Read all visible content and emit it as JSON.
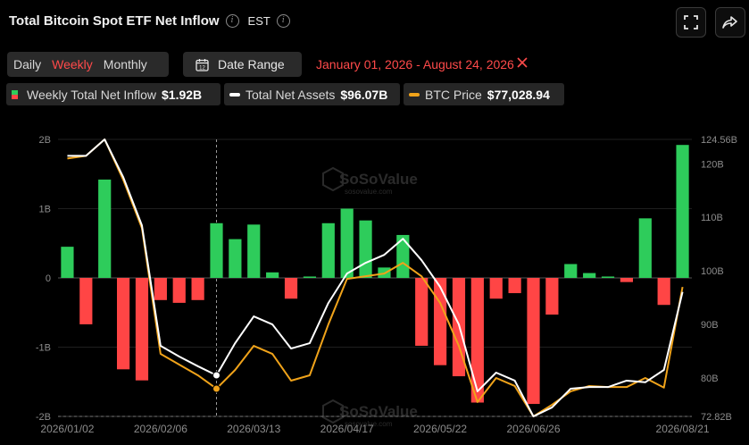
{
  "header": {
    "title": "Total Bitcoin Spot ETF Net Inflow",
    "timezone": "EST"
  },
  "controls": {
    "periods": [
      "Daily",
      "Weekly",
      "Monthly"
    ],
    "active_period": "Weekly",
    "date_range_label": "Date Range",
    "date_range_value": "January 01, 2026 - August 24, 2026"
  },
  "legend": {
    "inflow_label": "Weekly Total Net Inflow",
    "inflow_value": "$1.92B",
    "assets_label": "Total Net Assets",
    "assets_value": "$96.07B",
    "btc_label": "BTC Price",
    "btc_value": "$77,028.94"
  },
  "watermark": {
    "name": "SoSoValue",
    "url": "sosovalue.com"
  },
  "colors": {
    "positive": "#2ecc5b",
    "negative": "#ff4545",
    "assets_line": "#ffffff",
    "btc_line": "#f0a31a"
  },
  "chart_data": {
    "type": "bar",
    "left_axis": {
      "ticks": [
        2,
        1,
        0,
        -1,
        -2
      ],
      "tick_labels": [
        "2B",
        "1B",
        "0",
        "-1B",
        "-2B"
      ],
      "range": [
        -2,
        2
      ]
    },
    "right_axis": {
      "ticks": [
        124.56,
        120,
        110,
        100,
        90,
        80,
        72.82
      ],
      "tick_labels": [
        "124.56B",
        "120B",
        "110B",
        "100B",
        "90B",
        "80B",
        "72.82B"
      ],
      "range": [
        72.82,
        124.56
      ]
    },
    "x_tick_labels": [
      "2026/01/02",
      "2026/02/06",
      "2026/03/13",
      "2026/04/17",
      "2026/05/22",
      "2026/06/26",
      "2026/08/21"
    ],
    "x_tick_week_index": [
      0,
      5,
      10,
      15,
      20,
      25,
      33
    ],
    "weeks": 34,
    "highlight_week_index": 8,
    "net_inflow_billion": [
      0.45,
      -0.67,
      1.42,
      -1.32,
      -1.48,
      -0.32,
      -0.36,
      -0.32,
      0.79,
      0.56,
      0.77,
      0.08,
      -0.3,
      0.02,
      0.79,
      1.0,
      0.83,
      0.15,
      0.62,
      -0.98,
      -1.26,
      -1.42,
      -1.8,
      -0.3,
      -0.22,
      -1.82,
      -0.53,
      0.2,
      0.07,
      0.02,
      -0.06,
      0.86,
      -0.39,
      1.92
    ],
    "total_net_assets_billion": [
      121.5,
      121.5,
      124.56,
      117.5,
      108.5,
      86.0,
      84.0,
      82.2,
      80.5,
      86.5,
      91.5,
      90.0,
      85.5,
      86.5,
      94.0,
      99.5,
      101.5,
      103.0,
      106.0,
      102.0,
      97.0,
      90.0,
      77.5,
      81.0,
      79.5,
      72.82,
      74.5,
      78.0,
      78.3,
      78.3,
      79.5,
      79.2,
      81.5,
      96.07
    ],
    "btc_price_scaled": [
      121.0,
      121.5,
      124.56,
      117.0,
      108.0,
      84.5,
      82.5,
      80.5,
      78.0,
      81.5,
      86.0,
      84.5,
      79.5,
      80.5,
      90.0,
      98.5,
      99.0,
      99.5,
      101.5,
      99.0,
      94.0,
      86.0,
      75.5,
      80.0,
      78.5,
      72.82,
      75.0,
      77.5,
      78.5,
      78.3,
      78.3,
      80.0,
      78.2,
      97.0
    ]
  }
}
